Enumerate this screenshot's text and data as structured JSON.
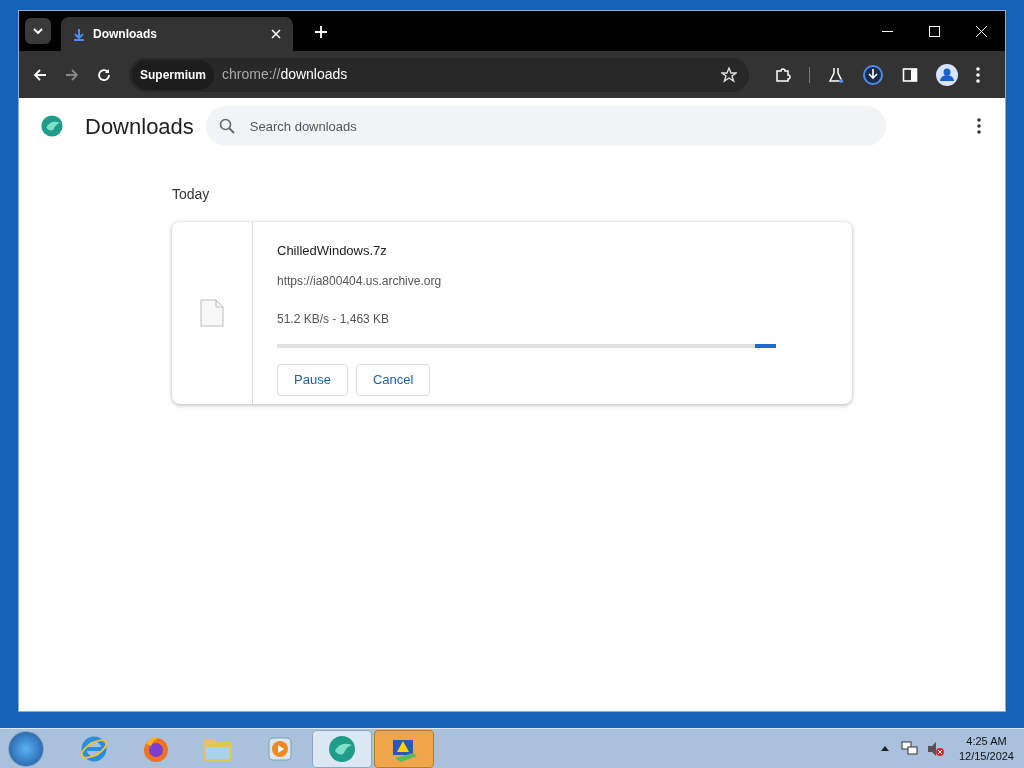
{
  "browser": {
    "tab": {
      "title": "Downloads",
      "selected": true
    },
    "address": {
      "chip": "Supermium",
      "scheme": "chrome://",
      "path": "downloads"
    }
  },
  "page": {
    "title": "Downloads",
    "search": {
      "placeholder": "Search downloads"
    },
    "groups": [
      {
        "heading": "Today",
        "items": [
          {
            "name": "ChilledWindows.7z",
            "url": "https://ia800404.us.archive.org",
            "status": "51.2 KB/s - 1,463 KB",
            "progress": {
              "kind": "indeterminate"
            },
            "buttons": [
              "Pause",
              "Cancel"
            ]
          }
        ]
      }
    ]
  },
  "taskbar": {
    "apps": [
      {
        "kind": "ie",
        "selected": false
      },
      {
        "kind": "firefox",
        "selected": false
      },
      {
        "kind": "folder",
        "selected": false
      },
      {
        "kind": "media",
        "selected": false
      },
      {
        "kind": "browser",
        "selected": true
      },
      {
        "kind": "warning",
        "selected": false
      }
    ],
    "time": "4:25 AM",
    "date": "12/15/2024"
  }
}
